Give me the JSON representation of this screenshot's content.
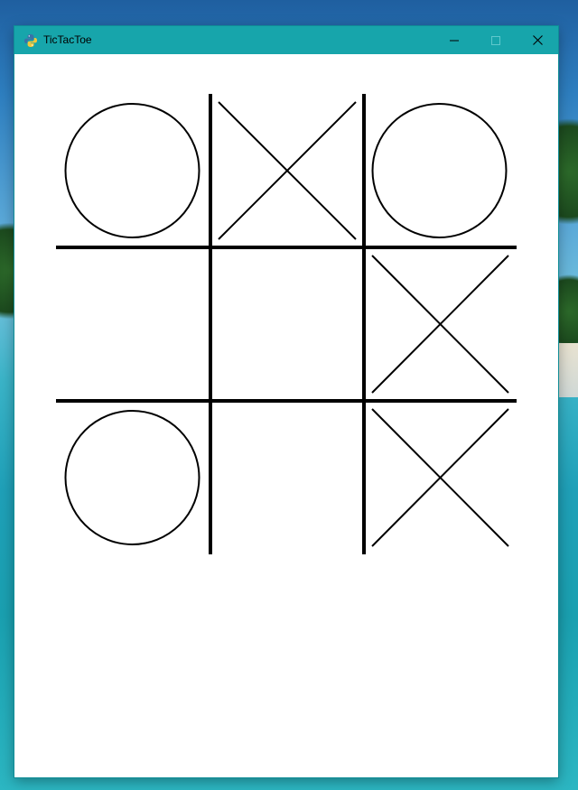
{
  "window": {
    "title": "TicTacToe",
    "app_icon": "python-icon",
    "controls": [
      "minimize-icon",
      "maximize-icon",
      "close-icon"
    ],
    "titlebar_color": "#17a5ab"
  },
  "board": {
    "rows": 3,
    "cols": 3,
    "cells": [
      [
        "O",
        "X",
        "O"
      ],
      [
        "",
        "",
        "X"
      ],
      [
        "O",
        "",
        "X"
      ]
    ],
    "line_color": "#000000",
    "background": "#ffffff"
  }
}
